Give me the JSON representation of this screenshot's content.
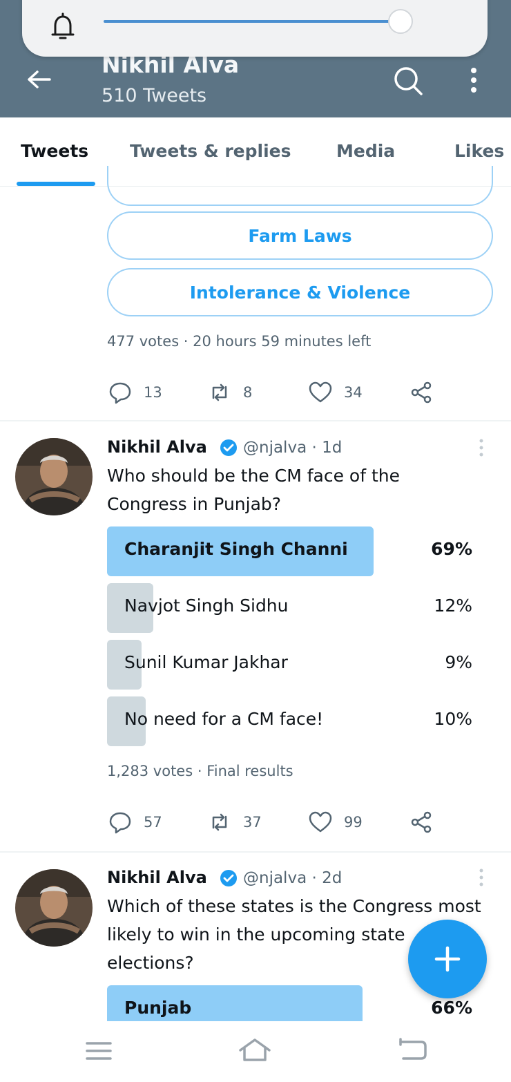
{
  "header": {
    "name": "Nikhil Alva",
    "tweet_count": "510 Tweets"
  },
  "quick_settings": {
    "brightness_level": 0.95
  },
  "tabs": [
    {
      "label": "Tweets",
      "active": true
    },
    {
      "label": "Tweets & replies",
      "active": false
    },
    {
      "label": "Media",
      "active": false
    },
    {
      "label": "Likes",
      "active": false
    }
  ],
  "poll1": {
    "options": [
      "Farm Laws",
      "Intolerance & Violence"
    ],
    "meta": "477 votes · 20 hours 59 minutes left",
    "actions": {
      "replies": "13",
      "retweets": "8",
      "likes": "34"
    }
  },
  "tweet2": {
    "name": "Nikhil Alva",
    "handle": "@njalva · 1d",
    "text": "Who should be the CM face of the Congress in Punjab?",
    "poll": [
      {
        "label": "Charanjit Singh Channi",
        "percent": "69%",
        "fraction": 0.69,
        "winner": true
      },
      {
        "label": "Navjot Singh Sidhu",
        "percent": "12%",
        "fraction": 0.12,
        "winner": false
      },
      {
        "label": "Sunil Kumar Jakhar",
        "percent": "9%",
        "fraction": 0.09,
        "winner": false
      },
      {
        "label": "No need for a CM face!",
        "percent": "10%",
        "fraction": 0.1,
        "winner": false
      }
    ],
    "meta": "1,283 votes · Final results",
    "actions": {
      "replies": "57",
      "retweets": "37",
      "likes": "99"
    }
  },
  "tweet3": {
    "name": "Nikhil Alva",
    "handle": "@njalva · 2d",
    "text": "Which of these states is the Congress most likely to win in the upcoming state elections?",
    "poll": [
      {
        "label": "Punjab",
        "percent": "66%",
        "fraction": 0.66,
        "winner": true
      }
    ]
  },
  "colors": {
    "accent": "#1d9bf0",
    "header_bg": "#5c7485",
    "poll_winner": "#8ecdf7",
    "poll_other": "#cfd9de"
  },
  "icons": {
    "back": "arrow-left-icon",
    "search": "search-icon",
    "more": "more-vertical-icon",
    "reply": "reply-icon",
    "retweet": "retweet-icon",
    "like": "heart-icon",
    "share": "share-icon",
    "verified": "verified-badge-icon",
    "compose": "plus-icon",
    "notification": "bell-icon"
  }
}
